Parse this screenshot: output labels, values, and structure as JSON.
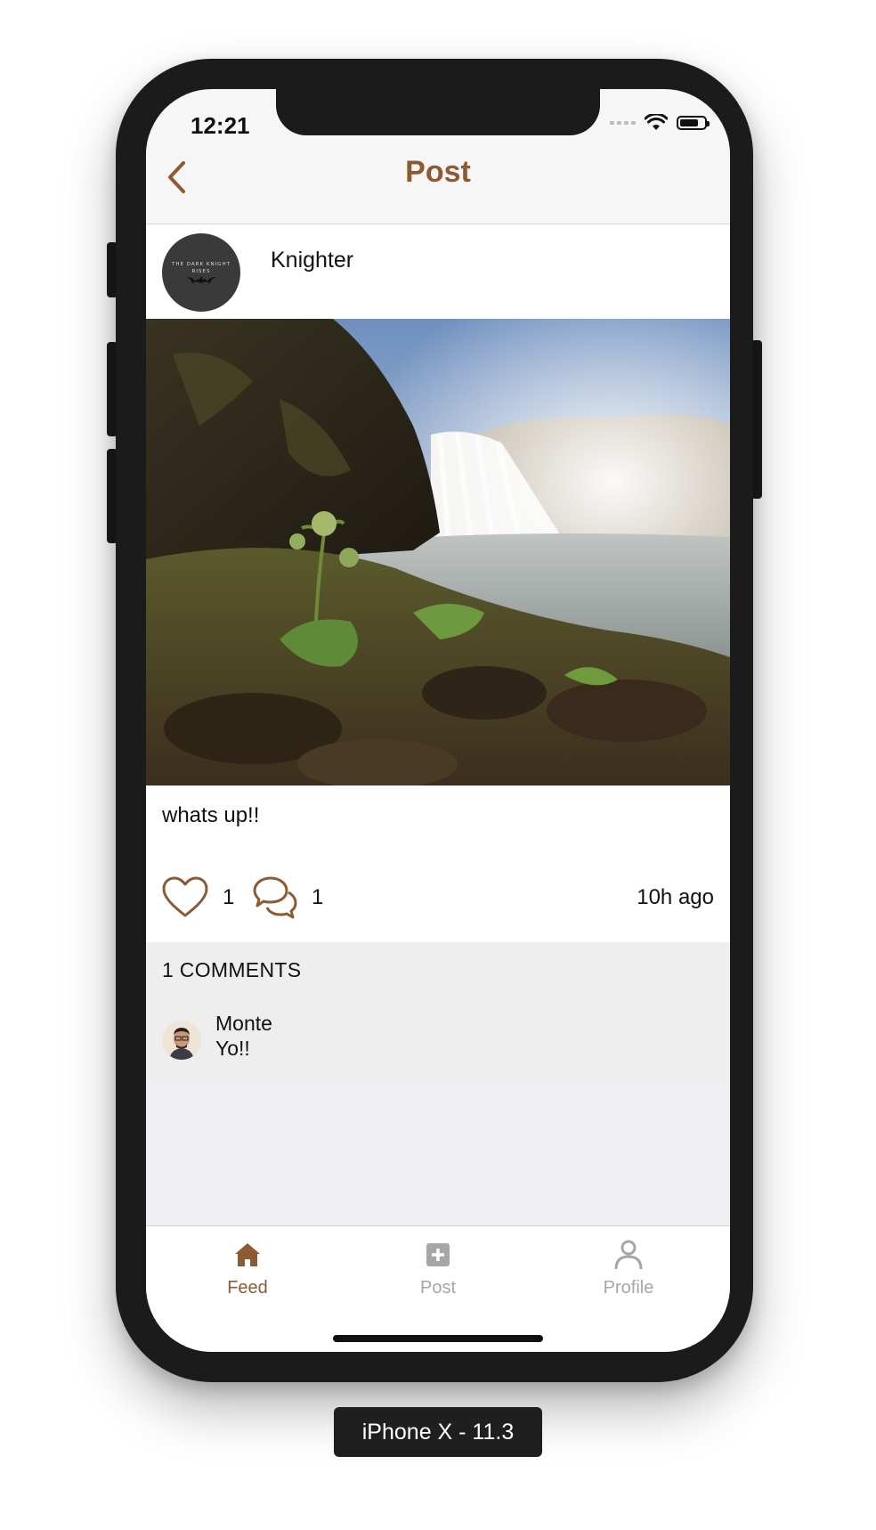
{
  "status_bar": {
    "time": "12:21"
  },
  "navbar": {
    "title": "Post",
    "back_icon": "chevron-left-icon"
  },
  "post": {
    "author": "Knighter",
    "avatar_text_line1": "THE DARK KNIGHT",
    "avatar_text_line2": "RISES",
    "caption": "whats up!!",
    "like_count": "1",
    "comment_count": "1",
    "time_ago": "10h ago"
  },
  "comments": {
    "title": "1 COMMENTS",
    "items": [
      {
        "author": "Monte",
        "text": "Yo!!"
      }
    ]
  },
  "tabbar": {
    "items": [
      {
        "label": "Feed",
        "icon": "home-icon",
        "active": true
      },
      {
        "label": "Post",
        "icon": "plus-square-icon",
        "active": false
      },
      {
        "label": "Profile",
        "icon": "person-icon",
        "active": false
      }
    ]
  },
  "device_label": "iPhone X - 11.3",
  "colors": {
    "accent": "#8c5a33",
    "inactive": "#a6a6a6",
    "device": "#1b1b1c"
  }
}
